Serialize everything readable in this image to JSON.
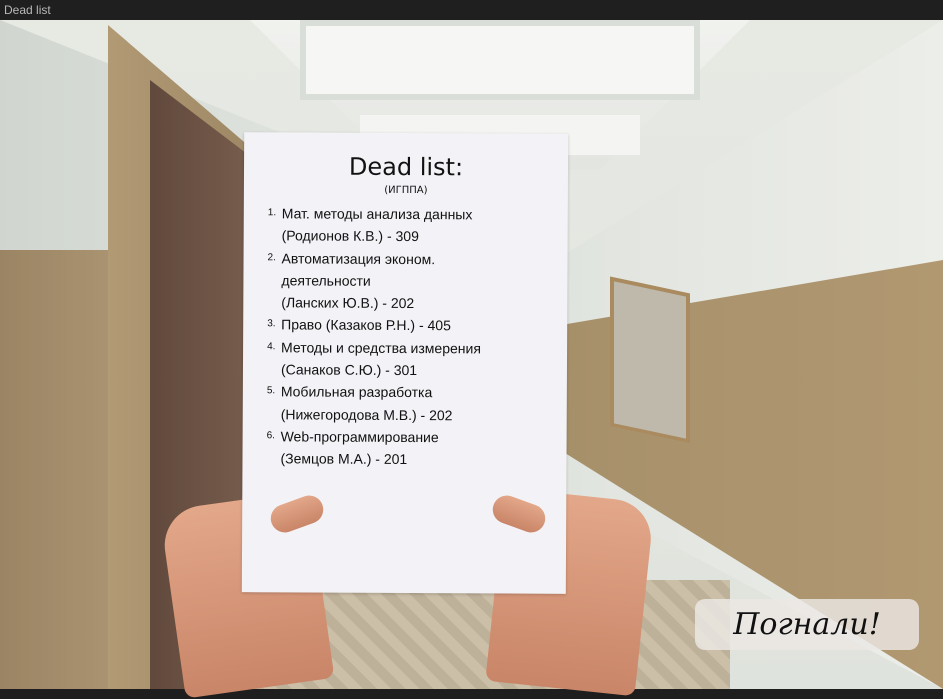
{
  "window": {
    "title": "Dead list"
  },
  "paper": {
    "title": "Dead list:",
    "subtitle": "(ИГППА)",
    "items": [
      {
        "num": "1.",
        "lines": [
          "Мат. методы анализа данных",
          "(Родионов К.В.) - 309"
        ]
      },
      {
        "num": "2.",
        "lines": [
          "Автоматизация эконом.",
          "деятельности",
          "(Ланских Ю.В.) - 202"
        ]
      },
      {
        "num": "3.",
        "lines": [
          "Право (Казаков Р.Н.) - 405"
        ]
      },
      {
        "num": "4.",
        "lines": [
          "Методы и средства измерения",
          "(Санаков С.Ю.) - 301"
        ]
      },
      {
        "num": "5.",
        "lines": [
          "Мобильная разработка",
          "(Нижегородова М.В.) - 202"
        ]
      },
      {
        "num": "6.",
        "lines": [
          "Web-программирование",
          "(Земцов М.А.) - 201"
        ]
      }
    ]
  },
  "go_button": {
    "label": "Погнали!"
  }
}
